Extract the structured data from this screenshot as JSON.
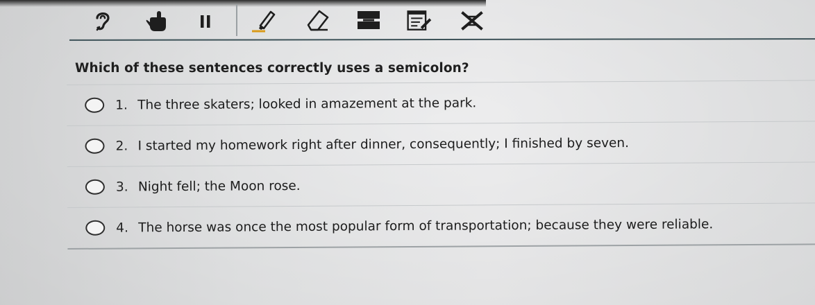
{
  "toolbar": {
    "tools": [
      {
        "name": "text-to-speech",
        "icon": "ear-icon"
      },
      {
        "name": "pointer",
        "icon": "hand-pointer-icon"
      },
      {
        "name": "pause",
        "icon": "pause-icon"
      },
      {
        "name": "highlighter",
        "icon": "highlighter-icon"
      },
      {
        "name": "eraser",
        "icon": "eraser-icon"
      },
      {
        "name": "line-reader",
        "icon": "line-reader-icon"
      },
      {
        "name": "notepad",
        "icon": "notepad-icon"
      },
      {
        "name": "answer-eliminator",
        "icon": "answer-eliminator-icon"
      }
    ]
  },
  "question": {
    "text": "Which of these sentences correctly uses a semicolon?",
    "answers": [
      {
        "number": "1.",
        "text": "The three skaters; looked in amazement at the park."
      },
      {
        "number": "2.",
        "text": "I started my homework right after dinner, consequently; I finished by seven."
      },
      {
        "number": "3.",
        "text": "Night fell; the Moon rose."
      },
      {
        "number": "4.",
        "text": "The horse was once the most popular form of transportation; because they were reliable."
      }
    ]
  },
  "colors": {
    "icon": "#1e1e1e",
    "rule": "#3d5258",
    "background": "#e8e9ea"
  }
}
